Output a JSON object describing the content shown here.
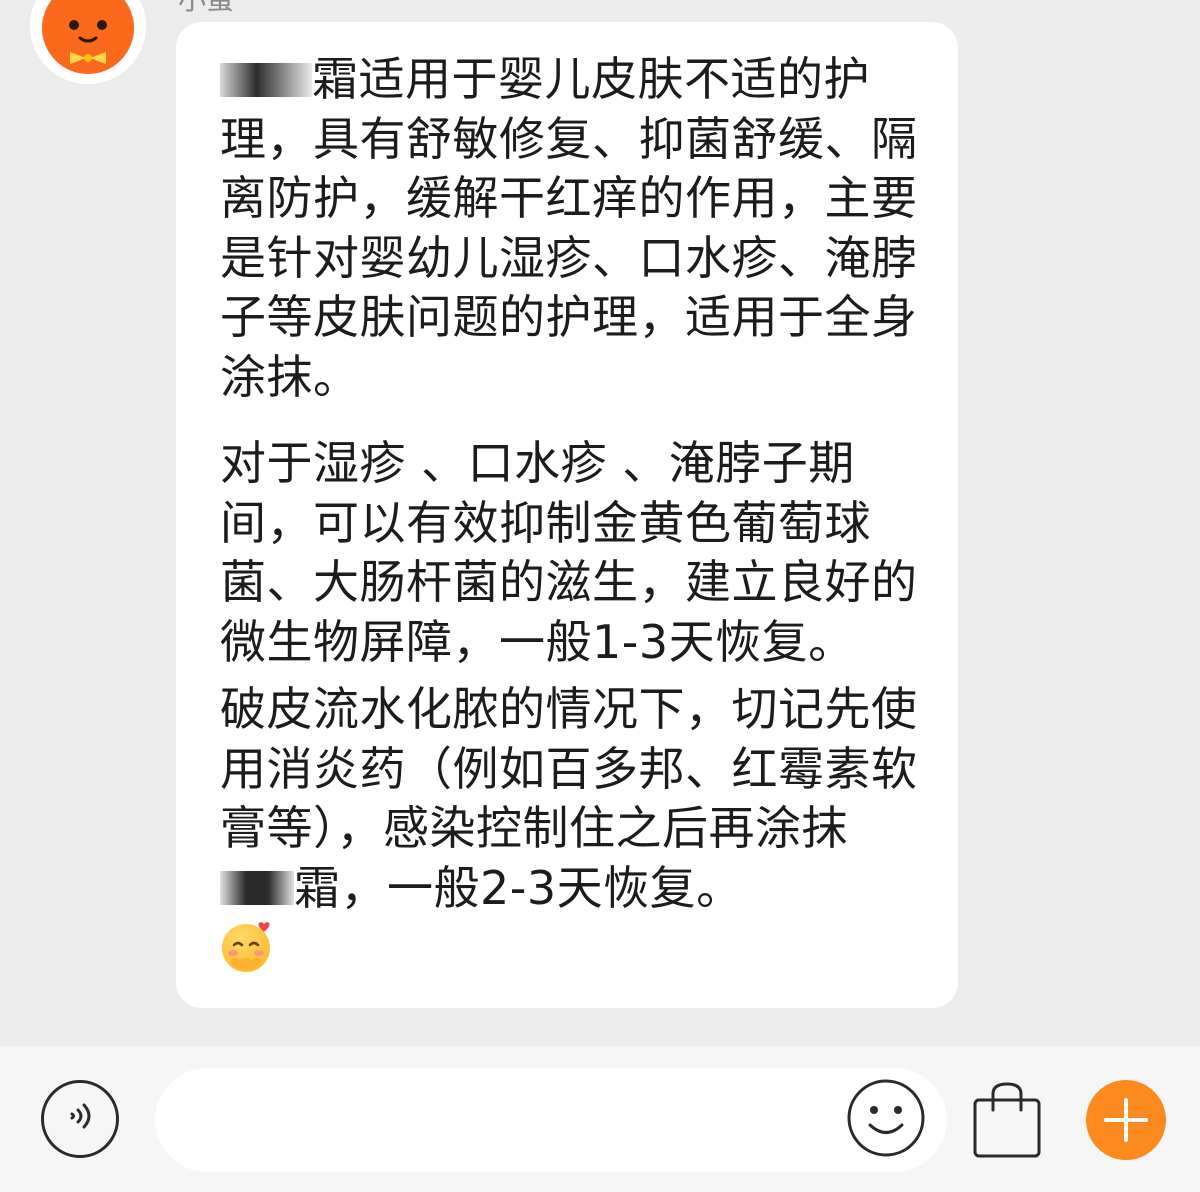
{
  "chat": {
    "sender_name": "小蜜",
    "message": {
      "para1_prefix": "",
      "para1_rest": "霜适用于婴儿皮肤不适的护理，具有舒敏修复、抑菌舒缓、隔离防护，缓解干红痒的作用，主要是针对婴幼儿湿疹、口水疹、淹脖子等皮肤问题的护理，适用于全身涂抹。",
      "para2": "对于湿疹 、口水疹 、淹脖子期间，可以有效抑制金黄色葡萄球菌、大肠杆菌的滋生，建立良好的微生物屏障，一般1-3天恢复。",
      "para3_prefix": "破皮流水化脓的情况下，切记先使用消炎药（例如百多邦、红霉素软膏等），感染控制住之后再涂抹",
      "para3_suffix": "霜，一般2-3天恢复。",
      "emoji": "🥰"
    }
  },
  "input_bar": {
    "placeholder": "",
    "voice_icon": "voice-icon",
    "emoji_icon": "smiley-icon",
    "bag_icon": "shopping-bag-icon",
    "plus_icon": "plus-icon"
  },
  "colors": {
    "chat_background": "#ececec",
    "bubble": "#ffffff",
    "accent_orange": "#fc8a1f",
    "avatar_orange": "#fb6a1c",
    "input_bar_background": "#f6f6f6"
  }
}
